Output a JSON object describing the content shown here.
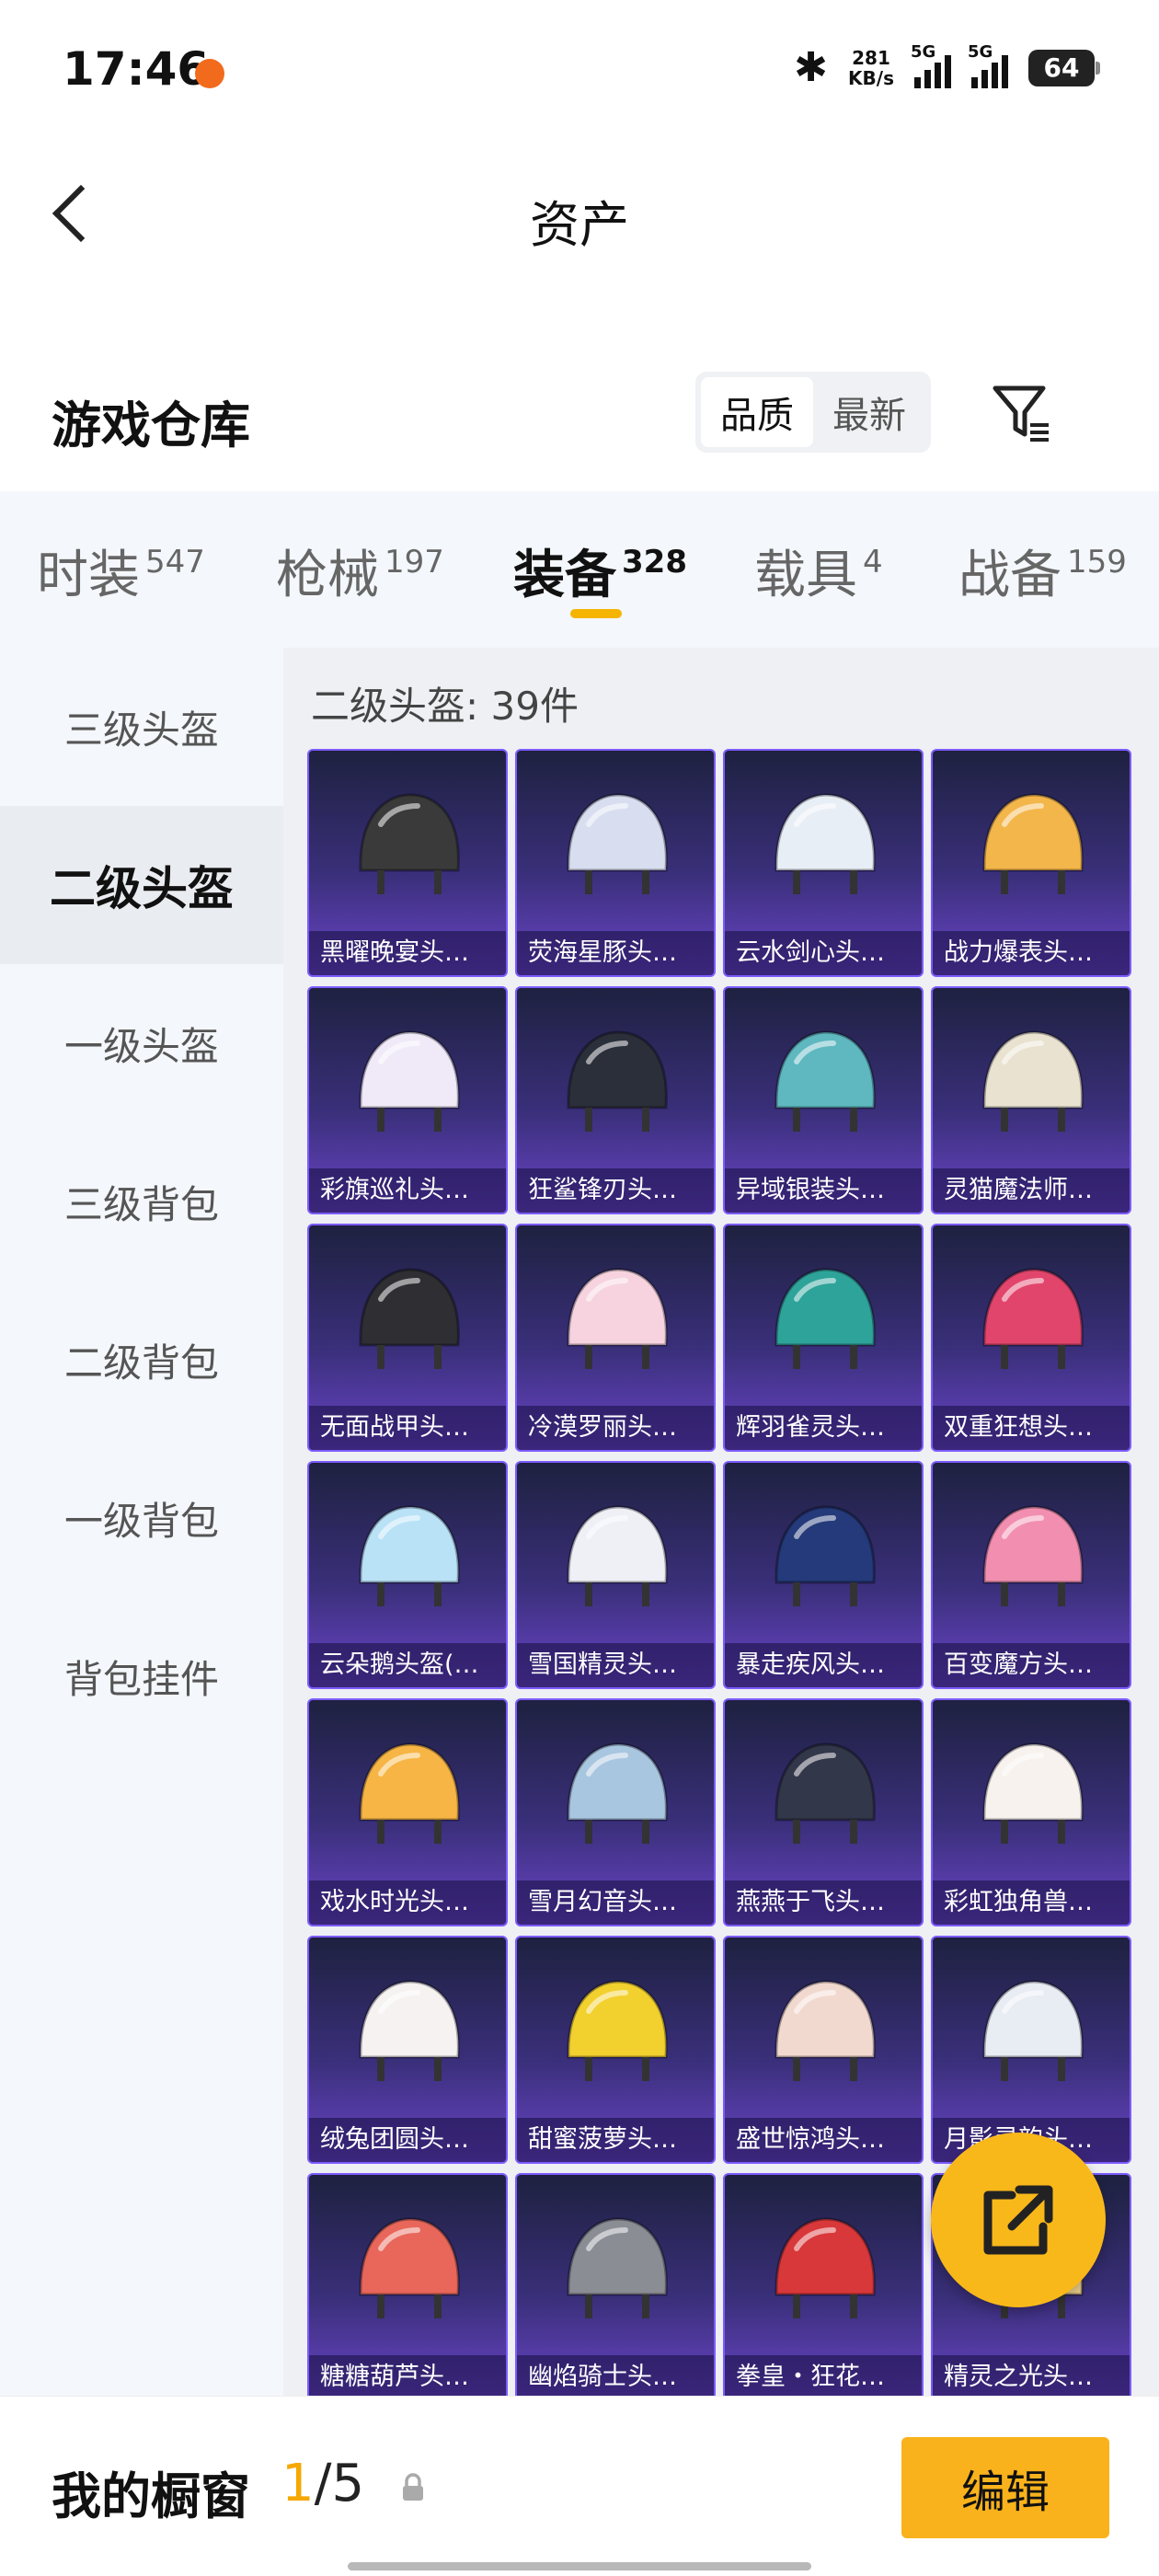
{
  "status_bar": {
    "time": "17:46",
    "net_speed_value": "281",
    "net_speed_unit": "KB/s",
    "sim1": "5G",
    "sim2": "5G",
    "battery": "64",
    "icons": [
      "notification-icon",
      "bluetooth-icon",
      "signal-icon",
      "battery-icon"
    ]
  },
  "header": {
    "title": "资产",
    "back_icon": "back-arrow-icon"
  },
  "warehouse": {
    "title": "游戏仓库",
    "sort_options": [
      "品质",
      "最新"
    ],
    "sort_selected": "品质",
    "filter_icon": "filter-icon"
  },
  "tabs": [
    {
      "label": "时装",
      "count": "547"
    },
    {
      "label": "枪械",
      "count": "197"
    },
    {
      "label": "装备",
      "count": "328"
    },
    {
      "label": "载具",
      "count": "4"
    },
    {
      "label": "战备",
      "count": "159"
    }
  ],
  "active_tab": "装备",
  "sidebar": {
    "items": [
      "三级头盔",
      "二级头盔",
      "一级头盔",
      "三级背包",
      "二级背包",
      "一级背包",
      "背包挂件"
    ],
    "active": "二级头盔"
  },
  "content": {
    "count_label": "二级头盔: 39件",
    "items": [
      {
        "name": "黑曜晚宴头…",
        "color": "#3a3a3a"
      },
      {
        "name": "荧海星豚头…",
        "color": "#d8def0"
      },
      {
        "name": "云水剑心头…",
        "color": "#e8eef6"
      },
      {
        "name": "战力爆表头…",
        "color": "#f3b64a"
      },
      {
        "name": "彩旗巡礼头…",
        "color": "#f0eaf8"
      },
      {
        "name": "狂鲨锋刃头…",
        "color": "#2b2f3a"
      },
      {
        "name": "异域银装头…",
        "color": "#5fb8c0"
      },
      {
        "name": "灵猫魔法师…",
        "color": "#e9e2d0"
      },
      {
        "name": "无面战甲头…",
        "color": "#2e2e33"
      },
      {
        "name": "冷漠罗丽头…",
        "color": "#f6d3de"
      },
      {
        "name": "辉羽雀灵头…",
        "color": "#2ea39a"
      },
      {
        "name": "双重狂想头…",
        "color": "#e2456c"
      },
      {
        "name": "云朵鹅头盔(…",
        "color": "#b9e2f7"
      },
      {
        "name": "雪国精灵头…",
        "color": "#eef0f5"
      },
      {
        "name": "暴走疾风头…",
        "color": "#243a7a"
      },
      {
        "name": "百变魔方头…",
        "color": "#f28fb0"
      },
      {
        "name": "戏水时光头…",
        "color": "#f6b544"
      },
      {
        "name": "雪月幻音头…",
        "color": "#a9c6e0"
      },
      {
        "name": "燕燕于飞头…",
        "color": "#33374a"
      },
      {
        "name": "彩虹独角兽…",
        "color": "#f7f2ee"
      },
      {
        "name": "绒兔团圆头…",
        "color": "#f6f2f2"
      },
      {
        "name": "甜蜜菠萝头…",
        "color": "#f2d02e"
      },
      {
        "name": "盛世惊鸿头…",
        "color": "#f2d9cf"
      },
      {
        "name": "月影灵韵头…",
        "color": "#e8ecf3"
      },
      {
        "name": "糖糖葫芦头…",
        "color": "#e8675a"
      },
      {
        "name": "幽焰骑士头…",
        "color": "#8a8d94"
      },
      {
        "name": "拳皇・狂花…",
        "color": "#d8383a"
      },
      {
        "name": "精灵之光头…",
        "color": "#f0d28c"
      }
    ]
  },
  "share_icon": "share-external-icon",
  "bottom_bar": {
    "title": "我的橱窗",
    "current": "1",
    "separator": "/",
    "total": "5",
    "lock_icon": "lock-icon",
    "edit_label": "编辑"
  },
  "colors": {
    "accent": "#f9b21c",
    "card_border": "#7d5cff",
    "sidebar_bg": "#f4f7fb"
  }
}
